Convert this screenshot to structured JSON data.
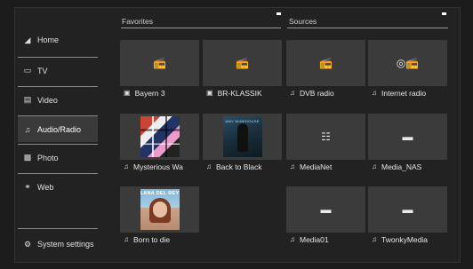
{
  "sidebar": {
    "items": [
      {
        "label": "Home",
        "icon": "home-icon"
      },
      {
        "label": "TV",
        "icon": "tv-icon"
      },
      {
        "label": "Video",
        "icon": "video-icon"
      },
      {
        "label": "Audio/Radio",
        "icon": "music-note-icon"
      },
      {
        "label": "Photo",
        "icon": "camera-icon"
      },
      {
        "label": "Web",
        "icon": "globe-icon"
      }
    ],
    "settings_label": "System settings",
    "active": "Audio/Radio"
  },
  "sections": {
    "favorites": "Favorites",
    "sources": "Sources"
  },
  "tiles": [
    {
      "caption": "Bayern 3",
      "type": "radio"
    },
    {
      "caption": "BR-KLASSIK",
      "type": "radio"
    },
    {
      "caption": "DVB radio",
      "type": "radio"
    },
    {
      "caption": "Internet radio",
      "type": "internet-radio"
    },
    {
      "caption": "Mysterious Wa",
      "type": "album"
    },
    {
      "caption": "Back to Black",
      "type": "album"
    },
    {
      "caption": "MediaNet",
      "type": "network"
    },
    {
      "caption": "Media_NAS",
      "type": "server"
    },
    {
      "caption": "Born to die",
      "type": "album"
    },
    {
      "caption": "Media01",
      "type": "server"
    },
    {
      "caption": "TwonkyMedia",
      "type": "server"
    }
  ],
  "covers": {
    "back_to_black_text": "AMY WINEHOUSE",
    "born_to_die_text": "LANA DEL REY"
  },
  "colors": {
    "background": "#1c1c1c",
    "tile": "#3b3b3b",
    "active_item": "#3a3a3a"
  }
}
